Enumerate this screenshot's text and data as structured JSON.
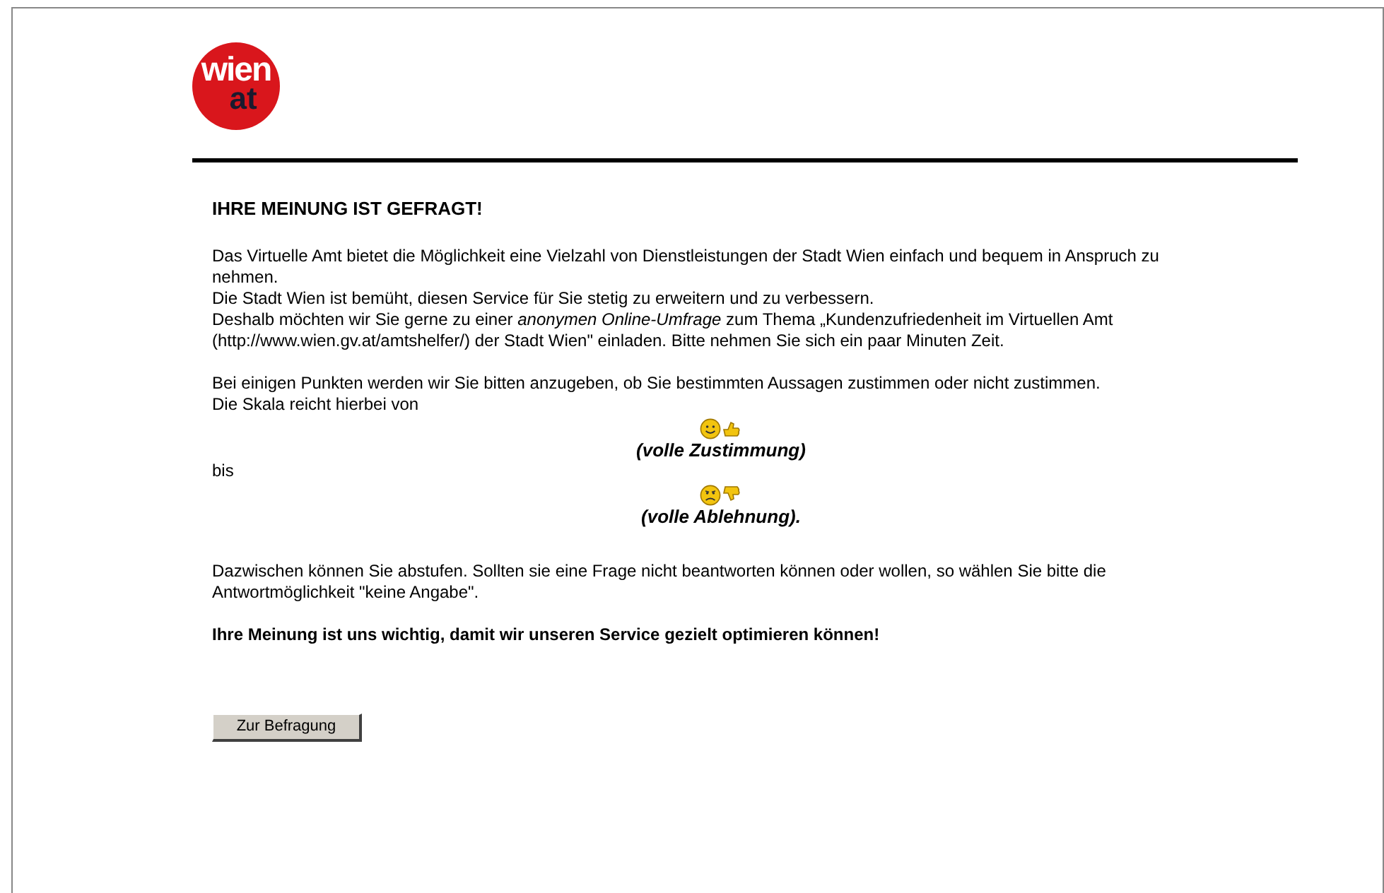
{
  "logo": {
    "line_1": "wien",
    "line_2": "at"
  },
  "heading": "IHRE MEINUNG IST GEFRAGT!",
  "intro": [
    "Das Virtuelle Amt bietet die Möglichkeit eine Vielzahl von Dienstleistungen der Stadt Wien einfach und bequem in Anspruch zu nehmen.",
    "Die Stadt Wien ist bemüht, diesen Service für Sie stetig zu erweitern und zu verbessern.",
    "Deshalb möchten wir Sie gerne zu einer *anonymen Online-Umfrage* zum Thema „Kundenzufriedenheit im Virtuellen Amt (http://www.wien.gv.at/amtshelfer/) der Stadt Wien\" einladen. Bitte nehmen Sie sich ein paar Minuten Zeit."
  ],
  "scale_intro": [
    "Bei einigen Punkten werden wir Sie bitten anzugeben, ob Sie bestimmten Aussagen zustimmen oder nicht zustimmen.",
    "Die Skala reicht hierbei von"
  ],
  "scale_top": {
    "label": "(volle Zustimmung)",
    "kind": "positive"
  },
  "between": "bis",
  "scale_bottom": {
    "label": "(volle Ablehnung)",
    "suffix": ".",
    "kind": "negative"
  },
  "explanation": "Dazwischen können Sie abstufen. Sollten sie eine Frage nicht beantworten können oder wollen, so wählen Sie bitte die Antwortmöglichkeit \"keine Angabe\".",
  "closing": "Ihre Meinung ist uns wichtig, damit wir unseren Service gezielt optimieren können!",
  "button": "Zur Befragung"
}
